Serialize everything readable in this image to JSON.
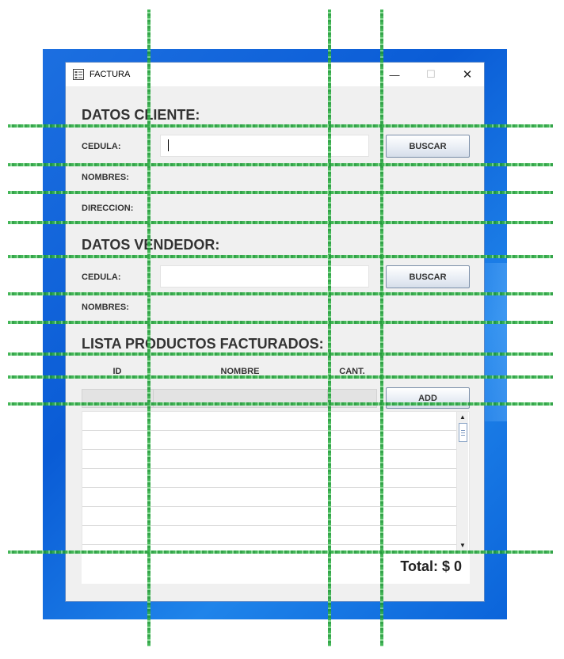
{
  "window": {
    "title": "FACTURA",
    "controls": {
      "minimize": "—",
      "maximize": "☐",
      "close": "✕"
    }
  },
  "cliente": {
    "title": "DATOS CLIENTE:",
    "cedula_label": "CEDULA:",
    "cedula_value": "",
    "nombres_label": "NOMBRES:",
    "direccion_label": "DIRECCION:",
    "buscar_label": "BUSCAR"
  },
  "vendedor": {
    "title": "DATOS VENDEDOR:",
    "cedula_label": "CEDULA:",
    "cedula_value": "",
    "nombres_label": "NOMBRES:",
    "buscar_label": "BUSCAR"
  },
  "productos": {
    "title": "LISTA PRODUCTOS FACTURADOS:",
    "columns": [
      "ID",
      "NOMBRE",
      "CANT."
    ],
    "add_label": "ADD",
    "rows": [],
    "total": "Total: $ 0"
  },
  "colors": {
    "desktop": "#0a5cd6",
    "window_bg": "#f0f0f0",
    "grid_overlay": "#36b64a"
  }
}
